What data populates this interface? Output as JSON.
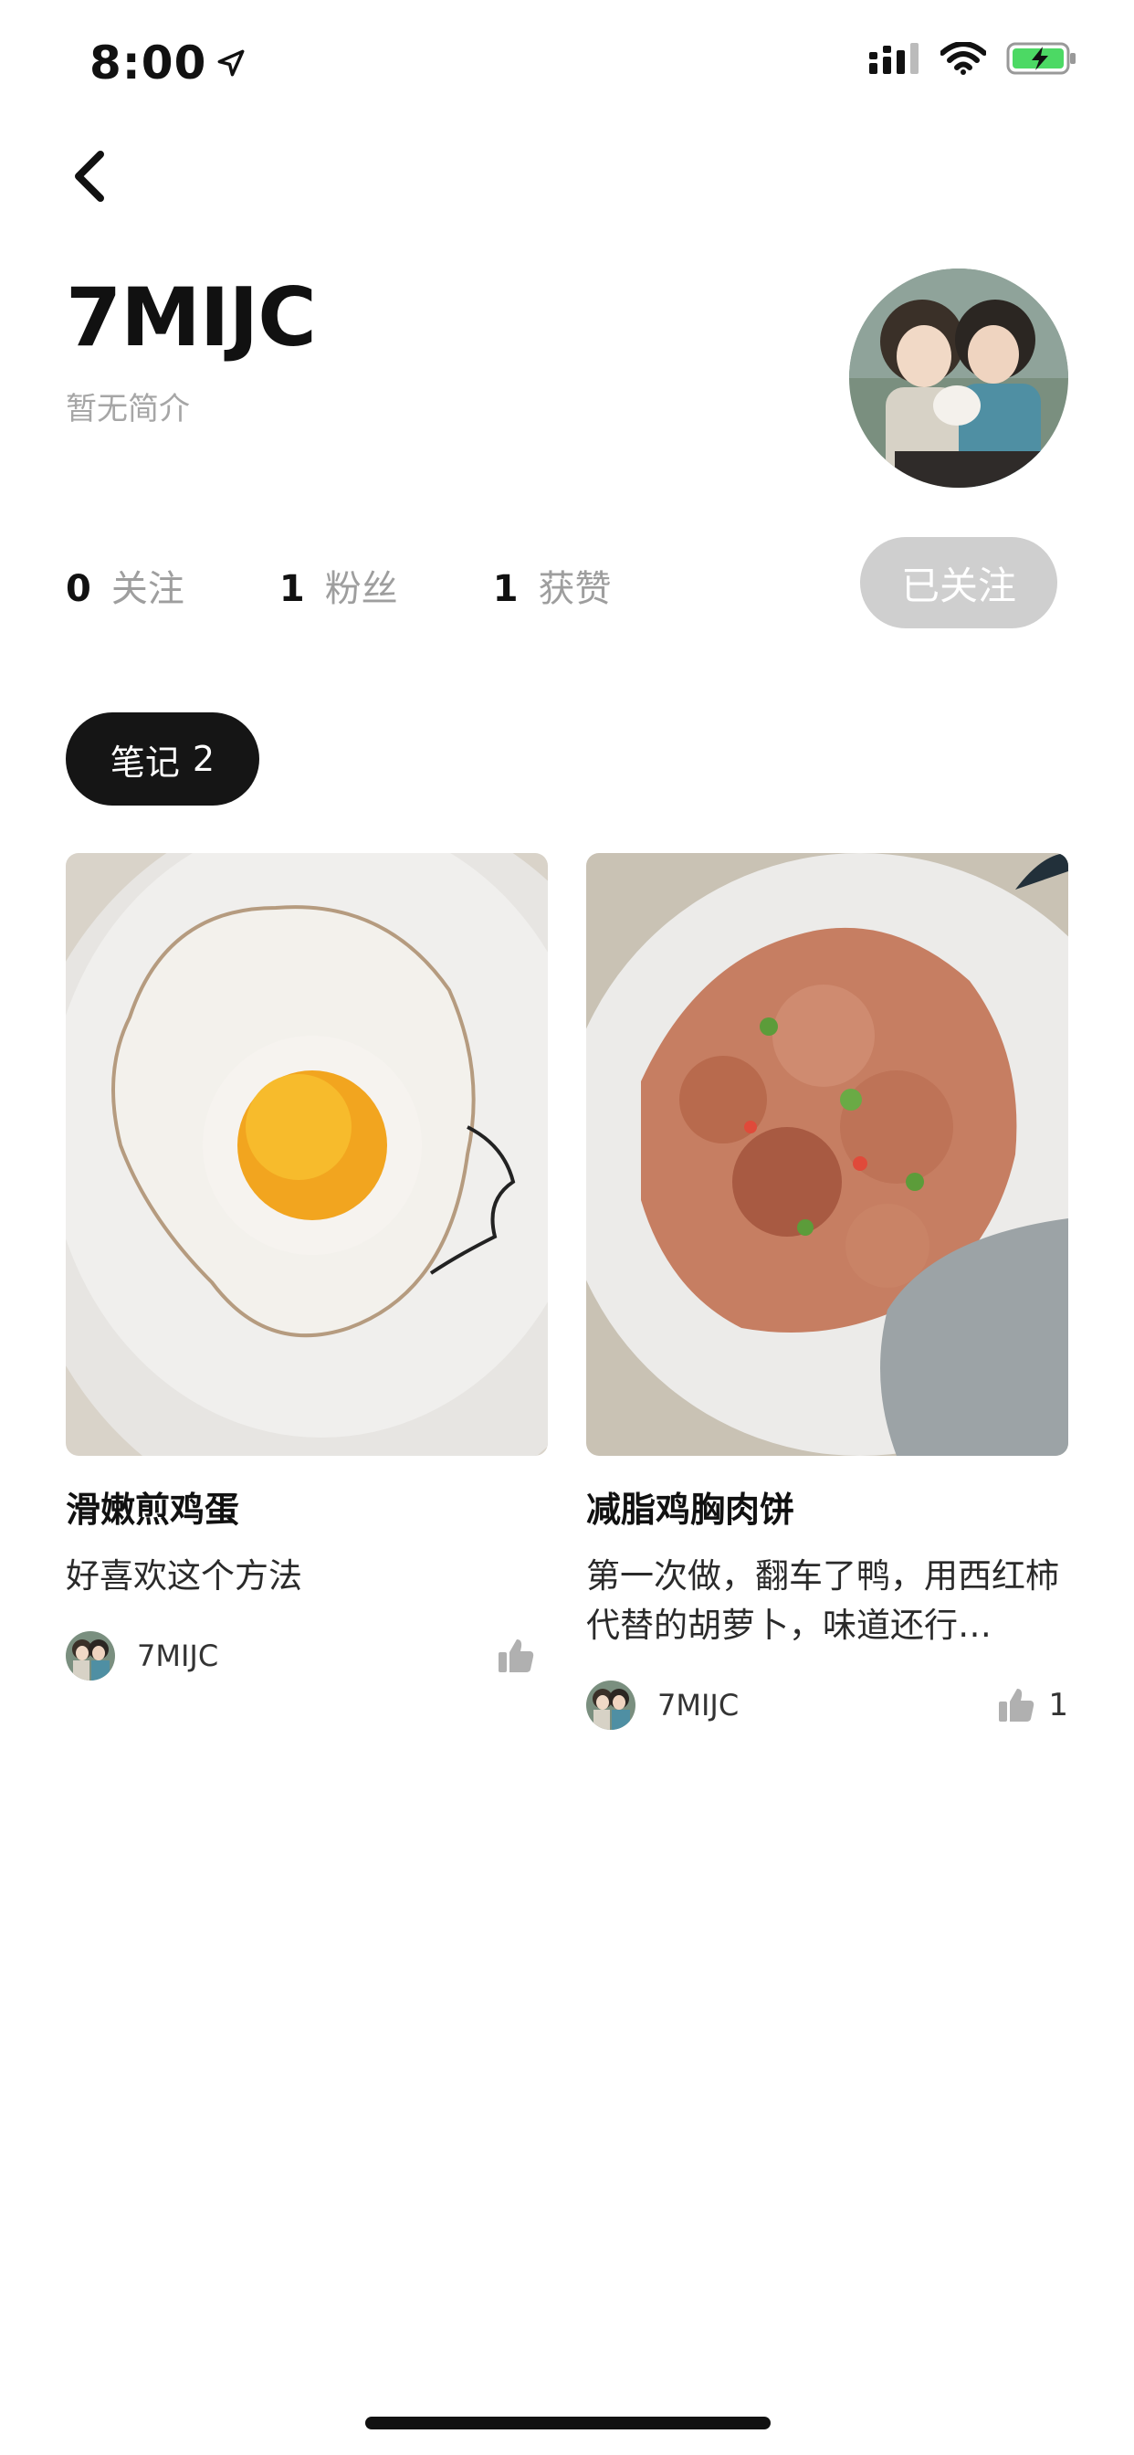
{
  "status_bar": {
    "time": "8:00",
    "location_icon": "location-arrow-icon",
    "signal_icon": "signal-icon",
    "wifi_icon": "wifi-icon",
    "battery_icon": "battery-charging-icon"
  },
  "nav": {
    "back_icon": "chevron-left-icon"
  },
  "profile": {
    "username": "7MIJC",
    "bio": "暂无简介",
    "avatar_icon": "avatar",
    "stats": [
      {
        "num": "0",
        "label": "关注"
      },
      {
        "num": "1",
        "label": "粉丝"
      },
      {
        "num": "1",
        "label": "获赞"
      }
    ],
    "follow_label": "已关注"
  },
  "tabs": {
    "notes_label": "笔记",
    "notes_count": "2"
  },
  "notes": [
    {
      "title": "滑嫩煎鸡蛋",
      "desc": "好喜欢这个方法",
      "author": "7MIJC",
      "likes": ""
    },
    {
      "title": "减脂鸡胸肉饼",
      "desc": "第一次做，翻车了鸭，用西红柿代替的胡萝卜，味道还行…",
      "author": "7MIJC",
      "likes": "1"
    }
  ],
  "colors": {
    "accent_dark": "#151515",
    "follow_bg": "#cfcfcf",
    "muted": "#9e9e9e"
  }
}
